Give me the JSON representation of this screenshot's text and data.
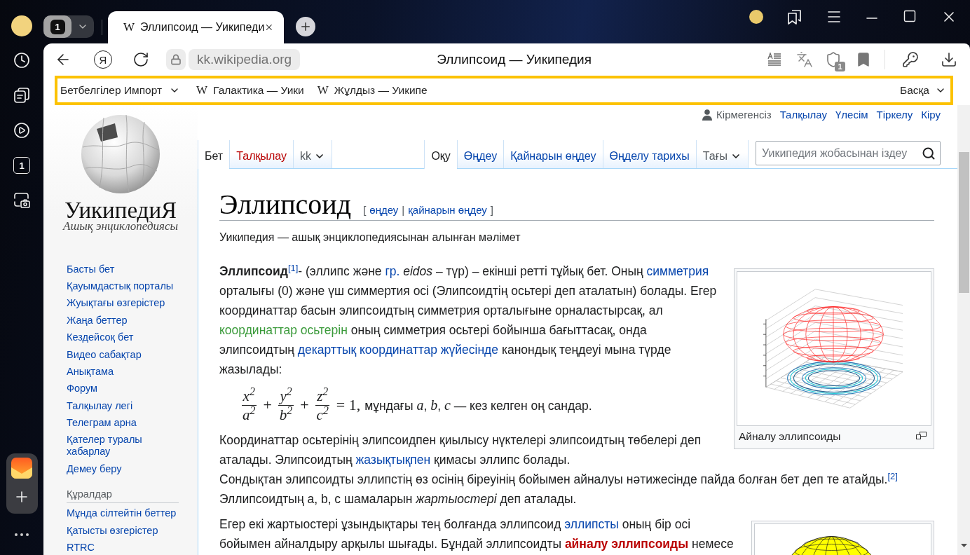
{
  "browser": {
    "sidebar": {
      "tab_count": "1"
    },
    "tab_group": {
      "count": "1"
    },
    "tabs": [
      {
        "favicon": "W",
        "title": "Эллипсоид — Уикипеди",
        "selected": true
      }
    ],
    "toolbar": {
      "home_button": "Я",
      "url": "kk.wikipedia.org",
      "page_title": "Эллипсоид — Уикипедия",
      "tracker_badge": "1"
    },
    "bookmarks_bar": {
      "folder": "Бетбелгілер Импорт",
      "items": [
        {
          "favicon": "W",
          "title": "Галактика — Уики"
        },
        {
          "favicon": "W",
          "title": "Жұлдыз — Уикипе"
        }
      ],
      "more": "Басқа"
    }
  },
  "page": {
    "logo": {
      "wordmark": "УикипедиЯ",
      "tagline": "Ашық энциклопедиясы"
    },
    "navigation": [
      "Басты бет",
      "Қауымдастық порталы",
      "Жуықтағы өзгерістер",
      "Жаңа беттер",
      "Кездейсоқ бет",
      "Видео сабақтар",
      "Анықтама",
      "Форум",
      "Талқылау легі",
      "Телеграм арна",
      "Қателер туралы хабарлау",
      "Демеу беру"
    ],
    "tools": {
      "heading": "Құралдар",
      "items": [
        "Мұнда сілтейтін беттер",
        "Қатысты өзгерістер",
        "RTRC"
      ]
    },
    "personal": {
      "status": "Кірмегенсіз",
      "links": [
        "Талқылау",
        "Үлесім",
        "Тіркелу",
        "Кіру"
      ]
    },
    "namespace_tabs": [
      {
        "label": "Бет",
        "kind": "tab",
        "selected": true
      },
      {
        "label": "Талқылау",
        "kind": "redlink",
        "selected": false
      },
      {
        "label": "kk",
        "kind": "dropdown",
        "selected": false
      }
    ],
    "view_tabs": [
      {
        "label": "Оқу",
        "kind": "tab",
        "selected": true
      },
      {
        "label": "Өңдеу",
        "kind": "tab",
        "selected": false
      },
      {
        "label": "Қайнарын өңдеу",
        "kind": "tab",
        "selected": false
      },
      {
        "label": "Өңделу тарихы",
        "kind": "tab",
        "selected": false
      },
      {
        "label": "Тағы",
        "kind": "dropdown",
        "selected": false
      }
    ],
    "search": {
      "placeholder": "Уикипедия жобасынан іздеу"
    },
    "article": {
      "title": "Эллипсоид",
      "edit_links": {
        "open": "[",
        "items": [
          "өңдеу",
          "қайнарын өңдеу"
        ],
        "separator": "|",
        "close": "]"
      },
      "site_sub": "Уикипедия — ашық энциклопедиясынан алынған мәлімет",
      "blocks": [
        {
          "kind": "paragraph",
          "figure": {
            "kind": "wireframe",
            "caption": "Айналу эллипсоиды"
          },
          "parts": [
            {
              "segments": [
                {
                  "kind": "text",
                  "text": "**Эллипсоид**"
                },
                {
                  "kind": "ref",
                  "text": "[1]"
                },
                {
                  "kind": "text",
                  "text": "- (эллипс және "
                },
                {
                  "kind": "link",
                  "text": "гр."
                },
                {
                  "kind": "text",
                  "text": " *eidos* – түр) – екінші ретті тұйық бет. Оның "
                },
                {
                  "kind": "link",
                  "text": "симметрия"
                },
                {
                  "kind": "text",
                  "text": " орталығы (0) және үш симмертия осі (Элипсоидтің осьтері деп аталатын) болады. Егер координаттар басын элипсоидтың симметрия орталығыне орналастырсақ, ал "
                },
                {
                  "kind": "redirect_link",
                  "text": "координаттар осьтерін"
                },
                {
                  "kind": "text",
                  "text": " оның симметрия осьтері бойынша бағыттасақ, онда элипсоидтың "
                },
                {
                  "kind": "link",
                  "text": "декарттық координаттар жүйесінде"
                },
                {
                  "kind": "text",
                  "text": " канондық теңдеуі мына түрде жазылады:"
                }
              ]
            }
          ]
        },
        {
          "kind": "formula",
          "terms": [
            {
              "numerator": "x$^{2}$",
              "denominator": "a$^{2}$"
            },
            {
              "numerator": "y$^{2}$",
              "denominator": "b$^{2}$"
            },
            {
              "numerator": "z$^{2}$",
              "denominator": "c$^{2}$"
            }
          ],
          "operators": [
            "+",
            "+"
          ],
          "result": "= 1,",
          "note": "мұндағы *a*, *b*, *c* — кез келген оң сандар."
        },
        {
          "kind": "paragraph",
          "parts": [
            {
              "segments": [
                {
                  "kind": "text",
                  "text": "Координаттар осьтерінің элипсоидпен қиылысу нүктелері элипсоидтың төбелері деп аталады. Элипсоидтың "
                },
                {
                  "kind": "link",
                  "text": "жазықтықпен"
                },
                {
                  "kind": "text",
                  "text": " қимасы эллипс болады."
                }
              ]
            },
            {
              "segments": [
                {
                  "kind": "text",
                  "text": "Сондықтан элипсоидты эллипстің өз осінің біреуінің бойымен айналуы нәтижесінде пайда болған бет деп те атайды."
                },
                {
                  "kind": "ref",
                  "text": "[2]"
                },
                {
                  "kind": "text",
                  "text": " Эллипсоидтың a, b, c шамаларын *жартыостері* деп аталады."
                }
              ]
            }
          ]
        },
        {
          "kind": "paragraph",
          "figure": {
            "kind": "surface"
          },
          "parts": [
            {
              "segments": [
                {
                  "kind": "text",
                  "text": "Егер екі жартыостері ұзындықтары тең болғанда эллипсоид "
                },
                {
                  "kind": "link",
                  "text": "эллипсты"
                },
                {
                  "kind": "text",
                  "text": " оның бір осі бойымен айналдыру арқылы шығады. Бұндай эллипсоидты "
                },
                {
                  "kind": "new_page_link",
                  "text": "айналу эллипсоиды"
                },
                {
                  "kind": "text",
                  "text": " немесе"
                }
              ]
            }
          ]
        }
      ]
    }
  }
}
